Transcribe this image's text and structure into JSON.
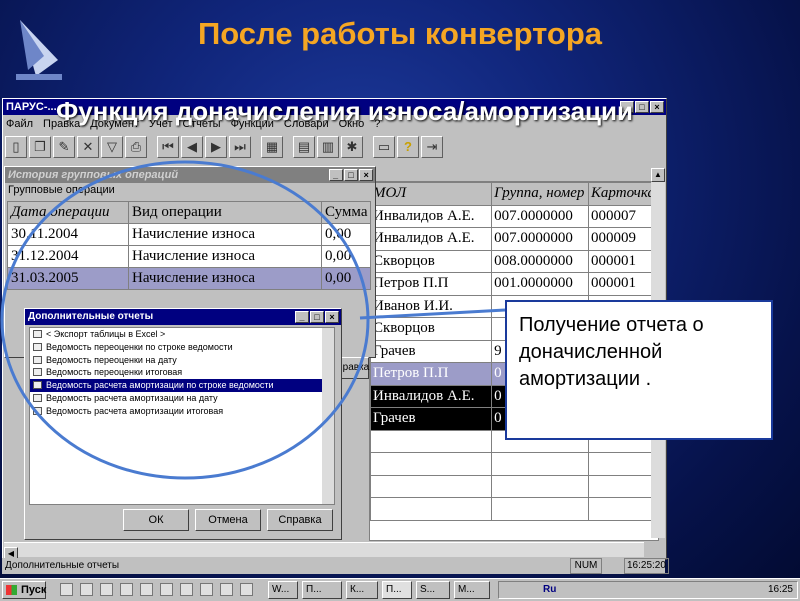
{
  "slide": {
    "title": "После работы конвертора",
    "subtitle": "Функция доначисления износа/амортизации"
  },
  "window": {
    "title": "ПАРУС-...",
    "menu": [
      "Файл",
      "Правка",
      "Документ",
      "Учет",
      "Отчеты",
      "Функции",
      "Словари",
      "Окно",
      "?"
    ]
  },
  "grid": {
    "headers": [
      "МОЛ",
      "Группа, номер",
      "Карточка"
    ],
    "rows": [
      [
        "Инвалидов А.Е.",
        "007.0000000",
        "000007"
      ],
      [
        "Инвалидов А.Е.",
        "007.0000000",
        "000009"
      ],
      [
        "Скворцов",
        "008.0000000",
        "000001"
      ],
      [
        "Петров П.П",
        "001.0000000",
        "000001"
      ],
      [
        "Иванов И.И.",
        "",
        ""
      ],
      [
        "Скворцов",
        "",
        ""
      ],
      [
        "Грачев",
        "9",
        ""
      ],
      [
        "Петров П.П",
        "0",
        ""
      ],
      [
        "Инвалидов А.Е.",
        "0",
        ""
      ],
      [
        "Грачев",
        "0",
        ""
      ]
    ]
  },
  "history": {
    "title": "История групповых операций",
    "label": "Групповые операции",
    "headers": [
      "Дата операции",
      "Вид операции",
      "Сумма"
    ],
    "rows": [
      [
        "30.11.2004",
        "Начисление износа",
        "0,00"
      ],
      [
        "31.12.2004",
        "Начисление износа",
        "0,00"
      ],
      [
        "31.03.2005",
        "Начисление износа",
        "0,00"
      ]
    ],
    "side_button": "Справка"
  },
  "dialog": {
    "title": "Дополнительные отчеты",
    "items": [
      "< Экспорт таблицы в Excel >",
      "Ведомость переоценки по строке ведомости",
      "Ведомость переоценки на дату",
      "Ведомость переоценки итоговая",
      "Ведомость расчета амортизации по строке ведомости",
      "Ведомость расчета амортизации на дату",
      "Ведомость расчета амортизации итоговая"
    ],
    "selected_index": 4,
    "ok": "ОК",
    "cancel": "Отмена",
    "help": "Справка"
  },
  "callout": {
    "text": "Получение отчета о доначисленной амортизации ."
  },
  "status": {
    "text": "Дополнительные отчеты",
    "num": "NUM",
    "time": "16:25:20"
  },
  "taskbar": {
    "start": "Пуск",
    "tasks": [
      "W...",
      "П...",
      "К...",
      "П...",
      "S...",
      "М..."
    ],
    "tray_lang": "Ru",
    "time": "16:25"
  },
  "colors": {
    "title_orange": "#f5a623",
    "slide_blue": "#10257a",
    "circle": "#4a7bd0"
  }
}
